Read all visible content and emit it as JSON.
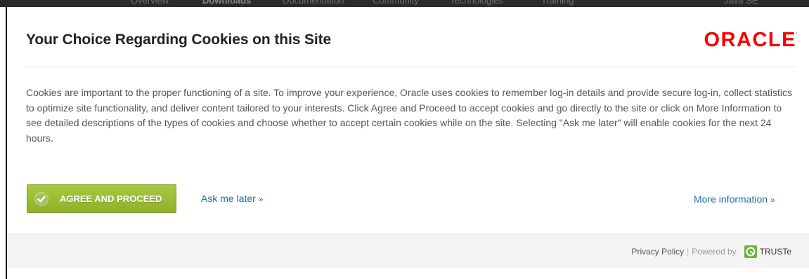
{
  "backdrop": {
    "nav_items": [
      "Overview",
      "Downloads",
      "Documentation",
      "Community",
      "Technologies",
      "Training"
    ],
    "right_text": "Java SE"
  },
  "dialog": {
    "title": "Your Choice Regarding Cookies on this Site",
    "logo_text": "ORACLE",
    "logo_color": "#f80000",
    "body": "Cookies are important to the proper functioning of a site. To improve your experience, Oracle uses cookies to remember log-in details and provide secure log-in, collect statistics to optimize site functionality, and deliver content tailored to your interests. Click Agree and Proceed to accept cookies and go directly to the site or click on More Information to see detailed descriptions of the types of cookies and choose whether to accept certain cookies while on the site. Selecting \"Ask me later\" will enable cookies for the next 24 hours.",
    "actions": {
      "agree_label": "AGREE AND PROCEED",
      "agree_icon": "check-circle-icon",
      "ask_later_label": "Ask me later",
      "more_info_label": "More information",
      "chevron": "»"
    },
    "footer": {
      "privacy_label": "Privacy Policy",
      "separator": "|",
      "powered_by": "Powered by",
      "truste_label": "TRUSTe",
      "truste_icon": "truste-icon"
    }
  },
  "colors": {
    "accent_green": "#9dbd35",
    "link_blue": "#1a6fb0",
    "title_text": "#222222",
    "body_text": "#555555"
  }
}
